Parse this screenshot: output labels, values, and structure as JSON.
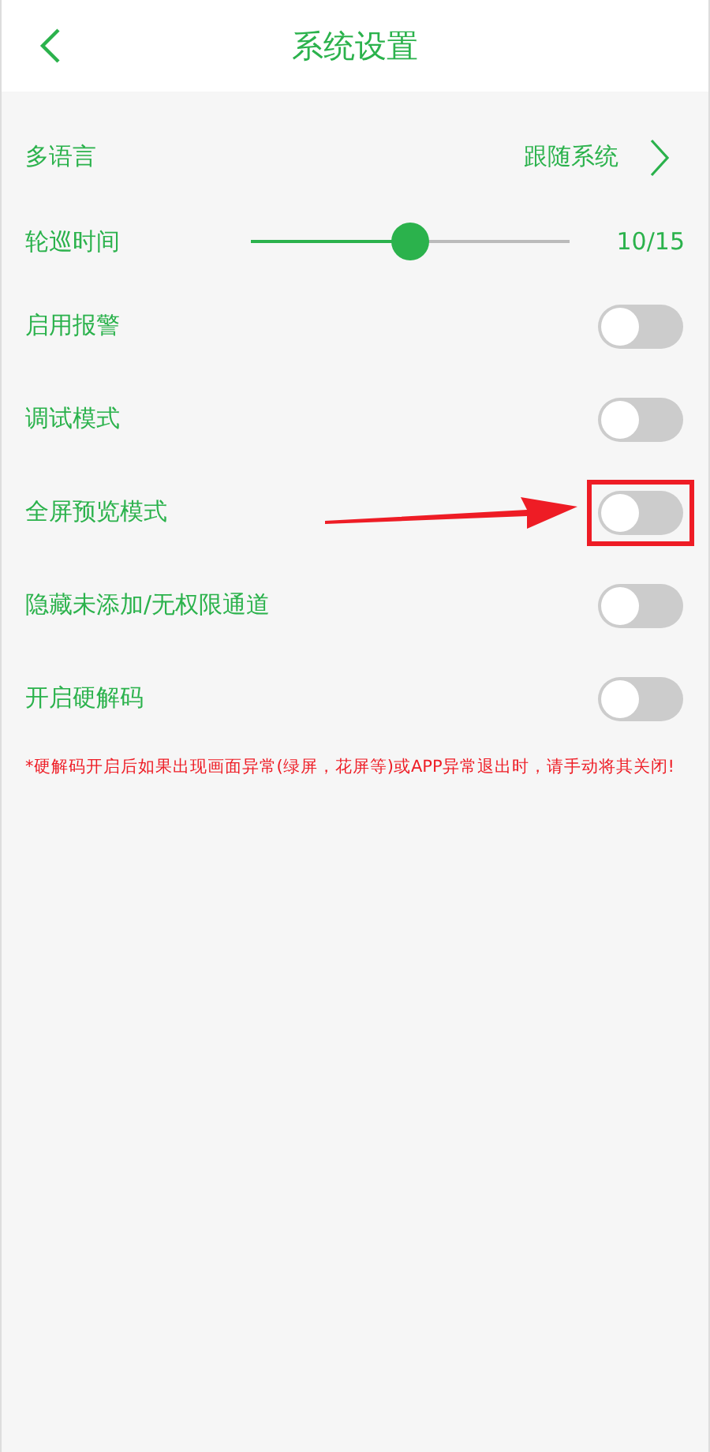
{
  "header": {
    "title": "系统设置"
  },
  "settings": [
    {
      "kind": "link",
      "label": "多语言",
      "value": "跟随系统"
    },
    {
      "kind": "slider",
      "label": "轮巡时间",
      "level": 0.5,
      "reading": "10/15"
    },
    {
      "kind": "toggle",
      "label": "启用报警",
      "on": false,
      "highlighted": false
    },
    {
      "kind": "toggle",
      "label": "调试模式",
      "on": false,
      "highlighted": false
    },
    {
      "kind": "toggle",
      "label": "全屏预览模式",
      "on": false,
      "highlighted": true
    },
    {
      "kind": "toggle",
      "label": "隐藏未添加/无权限通道",
      "on": false,
      "highlighted": false
    },
    {
      "kind": "toggle",
      "label": "开启硬解码",
      "on": false,
      "highlighted": false
    }
  ],
  "note": "*硬解码开启后如果出现画面异常(绿屏，花屏等)或APP异常退出时，请手动将其关闭!"
}
